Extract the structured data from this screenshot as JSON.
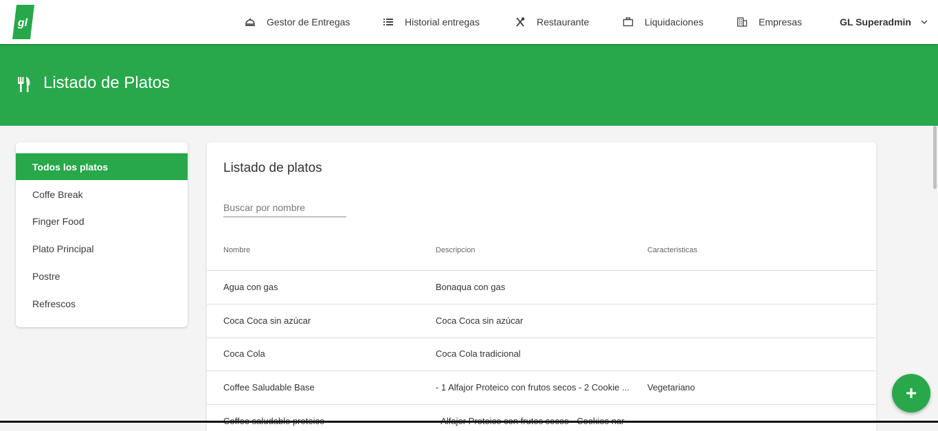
{
  "brand": {
    "logo_text": "gl",
    "color": "#28a84a"
  },
  "nav": {
    "items": [
      {
        "label": "Gestor de Entregas",
        "icon": "cloche-icon"
      },
      {
        "label": "Historial entregas",
        "icon": "list-icon"
      },
      {
        "label": "Restaurante",
        "icon": "utensils-cross-icon"
      },
      {
        "label": "Liquidaciones",
        "icon": "briefcase-icon"
      },
      {
        "label": "Empresas",
        "icon": "building-icon"
      }
    ],
    "user": "GL Superadmin"
  },
  "header": {
    "title": "Listado de Platos",
    "icon": "fork-knife-icon"
  },
  "sidebar": {
    "items": [
      {
        "label": "Todos los platos",
        "active": true
      },
      {
        "label": "Coffe Break"
      },
      {
        "label": "Finger Food"
      },
      {
        "label": "Plato Principal"
      },
      {
        "label": "Postre"
      },
      {
        "label": "Refrescos"
      }
    ]
  },
  "main": {
    "title": "Listado de platos",
    "search_placeholder": "Buscar por nombre",
    "columns": [
      "Nombre",
      "Descripcion",
      "Caracteristicas"
    ],
    "rows": [
      {
        "nombre": "Agua con gas",
        "descripcion": "Bonaqua con gas",
        "caracteristicas": ""
      },
      {
        "nombre": "Coca Coca sin azúcar",
        "descripcion": "Coca Coca sin azúcar",
        "caracteristicas": ""
      },
      {
        "nombre": "Coca Cola",
        "descripcion": "Coca Cola tradicional",
        "caracteristicas": ""
      },
      {
        "nombre": "Coffee Saludable Base",
        "descripcion": "- 1 Alfajor Proteico con frutos secos - 2 Cookie ...",
        "caracteristicas": "Vegetariano"
      },
      {
        "nombre": "Coffee saludable proteico",
        "descripcion": "- Alfajor Proteico con frutos secos - Cookies nar",
        "caracteristicas": ""
      }
    ]
  },
  "fab": {
    "label": "+",
    "icon": "plus-icon"
  }
}
